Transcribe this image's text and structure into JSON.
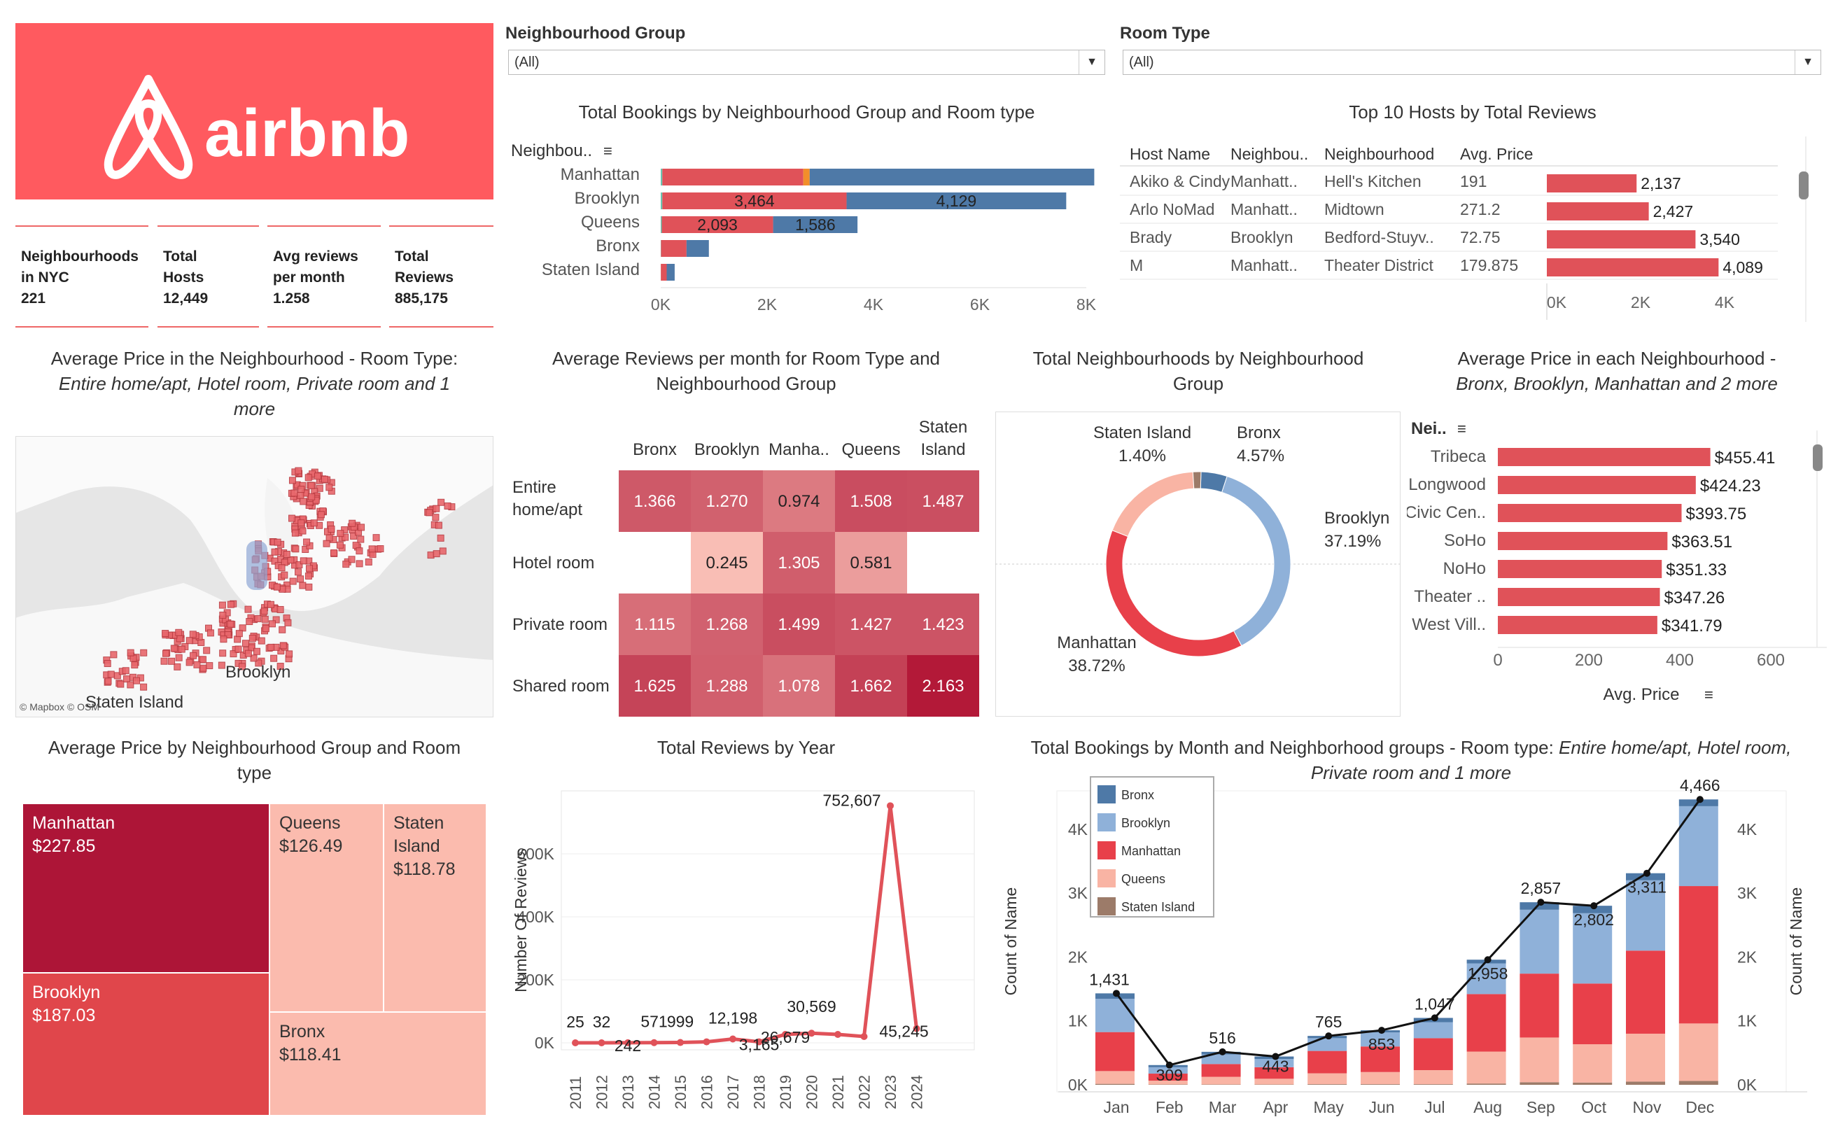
{
  "logo": {
    "text": "airbnb",
    "color": "#ff5a5f"
  },
  "colors": {
    "bronx": "#4e79a7",
    "brooklyn": "#8fb1d9",
    "manhattan": "#e8404a",
    "queens": "#f9b4a4",
    "staten": "#9c7b69",
    "red": "#e05259",
    "teal": "#6bc4b0",
    "orange": "#f28e2b"
  },
  "kpis": [
    {
      "label1": "Neighbourhoods",
      "label2": "in NYC",
      "value": "221"
    },
    {
      "label1": "Total",
      "label2": "Hosts",
      "value": "12,449"
    },
    {
      "label1": "Avg reviews",
      "label2": "per month",
      "value": "1.258"
    },
    {
      "label1": "Total",
      "label2": "Reviews",
      "value": "885,175"
    }
  ],
  "filters": {
    "group_label": "Neighbourhood Group",
    "group_value": "(All)",
    "room_label": "Room Type",
    "room_value": "(All)"
  },
  "titles": {
    "bookings": "Total Bookings by  Neighbourhood Group and Room type",
    "top_hosts": "Top 10 Hosts by Total Reviews",
    "map_line1": "Average Price in the Neighbourhood - Room Type:",
    "map_line2": "Entire home/apt, Hotel room, Private room and 1",
    "map_line3": "more",
    "heat_line1": "Average Reviews per month for Room Type and",
    "heat_line2": "Neighbourhood Group",
    "donut_line1": "Total Neighbourhoods by Neighbourhood",
    "donut_line2": "Group",
    "avgnb_line1": "Average Price in each Neighbourhood -",
    "avgnb_line2": "Bronx, Brooklyn, Manhattan and 2 more",
    "tree_line1": "Average Price by Neighbourhood Group and Room",
    "tree_line2": "type",
    "reviews_year": "Total Reviews by Year",
    "month_line1_a": "Total Bookings by Month and Neighborhood groups - Room type: ",
    "month_line1_b": "Entire home/apt, Hotel room,",
    "month_line2": "Private room and 1 more"
  },
  "chart_data": [
    {
      "id": "bookings",
      "type": "bar",
      "orientation": "horizontal",
      "stacked": true,
      "header": "Neighbou..",
      "categories": [
        "Manhattan",
        "Brooklyn",
        "Queens",
        "Bronx",
        "Staten Island"
      ],
      "series": [
        {
          "key": "shared",
          "values": [
            30,
            30,
            20,
            5,
            2
          ]
        },
        {
          "key": "private",
          "values": [
            2650,
            3464,
            2093,
            480,
            110
          ]
        },
        {
          "key": "hotel",
          "values": [
            120,
            0,
            0,
            0,
            0
          ]
        },
        {
          "key": "entire",
          "values": [
            5350,
            4129,
            1586,
            420,
            150
          ]
        }
      ],
      "labels": {
        "private": [
          "",
          "3,464",
          "2,093",
          "",
          ""
        ],
        "entire": [
          "",
          "4,129",
          "1,586",
          "",
          ""
        ]
      },
      "xticks": [
        "0K",
        "2K",
        "4K",
        "6K",
        "8K"
      ],
      "xlim": [
        0,
        8000
      ]
    },
    {
      "id": "top_hosts",
      "type": "table",
      "columns": [
        "Host Name",
        "Neighbou..",
        "Neighbourhood",
        "Avg. Price"
      ],
      "rows": [
        {
          "host": "Akiko & Cindy",
          "group": "Manhatt..",
          "nb": "Hell's Kitchen",
          "price": "191",
          "reviews": 2137,
          "label": "2,137"
        },
        {
          "host": "Arlo NoMad",
          "group": "Manhatt..",
          "nb": "Midtown",
          "price": "271.2",
          "reviews": 2427,
          "label": "2,427"
        },
        {
          "host": "Brady",
          "group": "Brooklyn",
          "nb": "Bedford-Stuyv..",
          "price": "72.75",
          "reviews": 3540,
          "label": "3,540"
        },
        {
          "host": "M",
          "group": "Manhatt..",
          "nb": "Theater District",
          "price": "179.875",
          "reviews": 4089,
          "label": "4,089"
        }
      ],
      "xticks": [
        "0K",
        "2K",
        "4K"
      ],
      "xlim": [
        0,
        5500
      ]
    },
    {
      "id": "map",
      "type": "scatter",
      "label_borough": "Brooklyn",
      "label_staten": "Staten Island",
      "attribution": "© Mapbox © OSM"
    },
    {
      "id": "heatmap",
      "type": "heatmap",
      "columns": [
        "Bronx",
        "Brooklyn",
        "Manha..",
        "Queens",
        "Staten Island"
      ],
      "col_header_lines": [
        [
          "",
          "Bronx"
        ],
        [
          "",
          "Brooklyn"
        ],
        [
          "",
          "Manha.."
        ],
        [
          "",
          "Queens"
        ],
        [
          "Staten",
          "Island"
        ]
      ],
      "rows": [
        {
          "label": [
            "Entire",
            "home/apt"
          ],
          "values": [
            1.366,
            1.27,
            0.974,
            1.508,
            1.487
          ],
          "text": [
            "1.366",
            "1.270",
            "0.974",
            "1.508",
            "1.487"
          ]
        },
        {
          "label": [
            "Hotel room"
          ],
          "values": [
            null,
            0.245,
            1.305,
            0.581,
            null
          ],
          "text": [
            "",
            "0.245",
            "1.305",
            "0.581",
            ""
          ]
        },
        {
          "label": [
            "Private room"
          ],
          "values": [
            1.115,
            1.268,
            1.499,
            1.427,
            1.423
          ],
          "text": [
            "1.115",
            "1.268",
            "1.499",
            "1.427",
            "1.423"
          ]
        },
        {
          "label": [
            "Shared room"
          ],
          "values": [
            1.625,
            1.288,
            1.078,
            1.662,
            2.163
          ],
          "text": [
            "1.625",
            "1.288",
            "1.078",
            "1.662",
            "2.163"
          ]
        }
      ]
    },
    {
      "id": "donut",
      "type": "pie",
      "slices": [
        {
          "name": "Bronx",
          "value": 4.57,
          "label": [
            "Bronx",
            "4.57%"
          ],
          "color": "#4e79a7"
        },
        {
          "name": "Brooklyn",
          "value": 37.19,
          "label": [
            "Brooklyn",
            "37.19%"
          ],
          "color": "#8fb1d9"
        },
        {
          "name": "Manhattan",
          "value": 38.72,
          "label": [
            "Manhattan",
            "38.72%"
          ],
          "color": "#e8404a"
        },
        {
          "name": "Queens",
          "value": 18.12,
          "label": [],
          "color": "#f9b4a4"
        },
        {
          "name": "Staten Island",
          "value": 1.4,
          "label": [
            "Staten Island",
            "1.40%"
          ],
          "color": "#9c7b69"
        }
      ]
    },
    {
      "id": "avg_nb",
      "type": "bar",
      "orientation": "horizontal",
      "header": "Nei..",
      "categories": [
        "Tribeca",
        "Longwood",
        "Civic Cen..",
        "SoHo",
        "NoHo",
        "Theater ..",
        "West Vill.."
      ],
      "values": [
        455.41,
        424.23,
        393.75,
        363.51,
        351.33,
        347.26,
        341.79
      ],
      "labels": [
        "$455.41",
        "$424.23",
        "$393.75",
        "$363.51",
        "$351.33",
        "$347.26",
        "$341.79"
      ],
      "xticks": [
        "0",
        "200",
        "400",
        "600"
      ],
      "xlim": [
        0,
        600
      ],
      "xlabel": "Avg. Price"
    },
    {
      "id": "treemap",
      "type": "treemap",
      "cells": [
        {
          "name": "Manhattan",
          "lines": [
            "Manhattan",
            "$227.85"
          ],
          "value": 227.85,
          "color": "#ad1537",
          "text": "#fff"
        },
        {
          "name": "Brooklyn",
          "lines": [
            "Brooklyn",
            "$187.03"
          ],
          "value": 187.03,
          "color": "#e0464b",
          "text": "#fff"
        },
        {
          "name": "Queens",
          "lines": [
            "Queens",
            "$126.49"
          ],
          "value": 126.49,
          "color": "#fbbbae",
          "text": "#333"
        },
        {
          "name": "Staten Island",
          "lines": [
            "Staten",
            "Island",
            "$118.78"
          ],
          "value": 118.78,
          "color": "#fbbbae",
          "text": "#333"
        },
        {
          "name": "Bronx",
          "lines": [
            "Bronx",
            "$118.41"
          ],
          "value": 118.41,
          "color": "#fbbbae",
          "text": "#333"
        }
      ]
    },
    {
      "id": "reviews_year",
      "type": "line",
      "x": [
        "2011",
        "2012",
        "2013",
        "2014",
        "2015",
        "2016",
        "2017",
        "2018",
        "2019",
        "2020",
        "2021",
        "2022",
        "2023",
        "2024"
      ],
      "y": [
        25,
        32,
        242,
        571,
        999,
        3165,
        12198,
        3165,
        26679,
        30569,
        26679,
        20000,
        752607,
        45245
      ],
      "point_labels": [
        "25",
        "32",
        "242",
        "571",
        "999",
        "",
        "12,198",
        "3,165",
        "26,679",
        "30,569",
        "",
        "",
        "752,607",
        "45,245"
      ],
      "ylabel": "Number Of Reviews",
      "yticks": [
        "0K",
        "200K",
        "400K",
        "600K"
      ],
      "ylim": [
        0,
        800000
      ]
    },
    {
      "id": "month",
      "type": "bar",
      "stacked": true,
      "categories": [
        "Jan",
        "Feb",
        "Mar",
        "Apr",
        "May",
        "Jun",
        "Jul",
        "Aug",
        "Sep",
        "Oct",
        "Nov",
        "Dec"
      ],
      "series": [
        {
          "name": "Staten Island",
          "values": [
            15,
            5,
            5,
            5,
            10,
            10,
            10,
            20,
            40,
            35,
            50,
            60
          ]
        },
        {
          "name": "Queens",
          "values": [
            200,
            60,
            120,
            90,
            170,
            190,
            220,
            500,
            700,
            600,
            750,
            900
          ]
        },
        {
          "name": "Manhattan",
          "values": [
            610,
            110,
            200,
            180,
            350,
            400,
            500,
            900,
            1000,
            950,
            1300,
            2150
          ]
        },
        {
          "name": "Brooklyn",
          "values": [
            520,
            100,
            150,
            130,
            200,
            220,
            250,
            480,
            1000,
            1100,
            1100,
            1250
          ]
        },
        {
          "name": "Bronx",
          "values": [
            86,
            34,
            41,
            38,
            35,
            33,
            67,
            58,
            117,
            117,
            111,
            106
          ]
        }
      ],
      "totals_line": [
        1431,
        309,
        516,
        443,
        765,
        853,
        1047,
        1958,
        2857,
        2802,
        3311,
        4466
      ],
      "total_labels": [
        "1,431",
        "309",
        "516",
        "443",
        "765",
        "853",
        "1,047",
        "1,958",
        "2,857",
        "2,802",
        "3,311",
        "4,466"
      ],
      "ylabel": "Count of Name",
      "yticks": [
        "0K",
        "1K",
        "2K",
        "3K",
        "4K"
      ],
      "ylim": [
        0,
        4600
      ]
    }
  ]
}
